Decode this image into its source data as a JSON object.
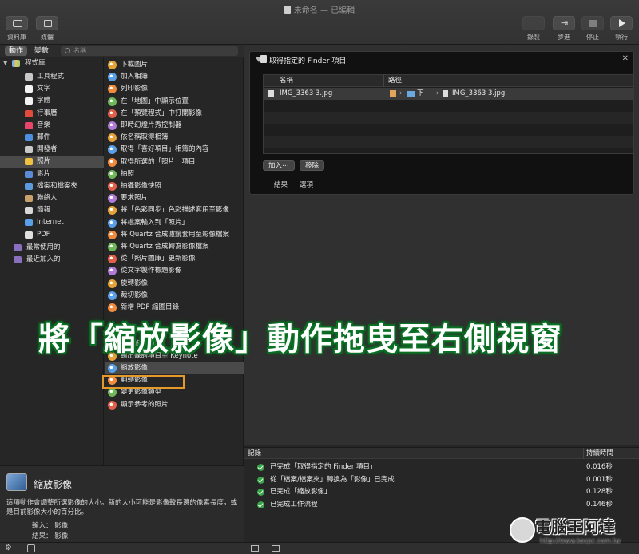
{
  "window": {
    "title": "未命名 — 已編輯"
  },
  "toolbar": {
    "library_label": "資料庫",
    "media_label": "媒體",
    "record_label": "錄製",
    "step_label": "步進",
    "stop_label": "停止",
    "run_label": "執行"
  },
  "libbar": {
    "actions_tab": "動作",
    "variables_tab": "變數",
    "search_placeholder": "名稱"
  },
  "library": {
    "root": "程式庫",
    "items": [
      {
        "label": "工具程式",
        "color": "#c8c8c8"
      },
      {
        "label": "文字",
        "color": "#f2f2f2"
      },
      {
        "label": "字體",
        "color": "#f2f2f2"
      },
      {
        "label": "行事曆",
        "color": "#e24b3b"
      },
      {
        "label": "音樂",
        "color": "#e8456a"
      },
      {
        "label": "郵件",
        "color": "#4e8fe0"
      },
      {
        "label": "開發者",
        "color": "#c8c8c8"
      },
      {
        "label": "照片",
        "color": "#f0c040"
      },
      {
        "label": "影片",
        "color": "#5b8bd6"
      },
      {
        "label": "檔案和檔案夾",
        "color": "#5b9be0"
      },
      {
        "label": "聯絡人",
        "color": "#c9a26b"
      },
      {
        "label": "簡報",
        "color": "#d8d8d8"
      },
      {
        "label": "Internet",
        "color": "#5aa0e8"
      },
      {
        "label": "PDF",
        "color": "#e0e0e0"
      }
    ],
    "recent": "最常使用的",
    "added": "最近加入的"
  },
  "actions": [
    "下載圖片",
    "加入相簿",
    "列印影像",
    "在「地圖」中顯示位置",
    "在「預覽程式」中打開影像",
    "即時幻燈片秀控制器",
    "依名稱取得相簿",
    "取得「喜好項目」相簿的內容",
    "取得所選的「照片」項目",
    "拍照",
    "拍攝影像快照",
    "要求照片",
    "將「色彩同步」色彩描述套用至影像",
    "將檔案輸入到「照片」",
    "將 Quartz 合成濾鏡套用至影像檔案",
    "將 Quartz 合成轉為影像檔案",
    "從「照片圖庫」更新影像",
    "從文字製作標題影像",
    "旋轉影像",
    "裁切影像",
    "新增 PDF 縮圖目錄",
    "",
    "",
    "輸出媒體項目",
    "輸出媒體項目至 Keynote",
    "縮放影像",
    "翻轉影像",
    "變更影像類型",
    "顯示參考的照片"
  ],
  "description": {
    "title": "縮放影像",
    "text": "這項動作會調整所選影像的大小。新的大小可能是影像較長邊的像素長度，或是目前影像大小的百分比。",
    "input_label": "輸入：",
    "input_value": "影像",
    "result_label": "結果：",
    "result_value": "影像"
  },
  "card": {
    "title": "取得指定的 Finder 項目",
    "col_name": "名稱",
    "col_path": "路徑",
    "file_name": "IMG_3363 3.jpg",
    "path_seg": "下",
    "path_file": "IMG_3363 3.jpg",
    "add_button": "加入⋯",
    "remove_button": "移除",
    "tab_results": "結果",
    "tab_options": "選項"
  },
  "log": {
    "col_log": "記錄",
    "col_duration": "持續時間",
    "rows": [
      {
        "text": "已完成「取得指定的 Finder 項目」",
        "time": "0.016秒"
      },
      {
        "text": "從「檔案/檔案夾」轉換為「影像」已完成",
        "time": "0.001秒"
      },
      {
        "text": "已完成「縮放影像」",
        "time": "0.128秒"
      },
      {
        "text": "已完成工作流程",
        "time": "0.146秒"
      }
    ]
  },
  "overlay": {
    "caption": "將「縮放影像」動作拖曳至右側視窗"
  },
  "watermark": {
    "title": "電腦王阿達",
    "url": "http://www.kocpc.com.tw"
  }
}
